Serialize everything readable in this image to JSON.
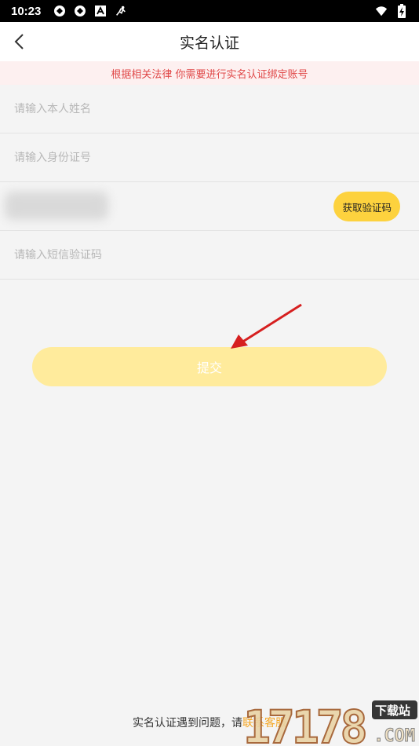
{
  "status_bar": {
    "time": "10:23",
    "left_icons": [
      "sync-icon",
      "sync-icon",
      "notification-a-icon",
      "running-icon"
    ],
    "right_icons": [
      "wifi-icon",
      "battery-charging-icon"
    ]
  },
  "nav": {
    "title": "实名认证",
    "back_icon": "chevron-left-icon"
  },
  "notice": {
    "text": "根据相关法律 你需要进行实名认证绑定账号",
    "color": "#e04848",
    "background": "#fdf0f0"
  },
  "form": {
    "name_placeholder": "请输入本人姓名",
    "name_value": "",
    "id_placeholder": "请输入身份证号",
    "id_value": "",
    "phone_value": "",
    "sms_button_label": "获取验证码",
    "sms_code_placeholder": "请输入短信验证码",
    "sms_code_value": ""
  },
  "submit": {
    "label": "提交",
    "color": "#ffeb9c"
  },
  "footer": {
    "text": "实名认证遇到问题，请",
    "link_text": "联系客服",
    "link_color": "#f5a623"
  },
  "watermark": {
    "brand": "17178",
    "tag": "下载站",
    "domain": "COM"
  },
  "colors": {
    "accent": "#fdd23e",
    "background": "#f4f4f4",
    "annotation_arrow": "#d61f1f"
  }
}
